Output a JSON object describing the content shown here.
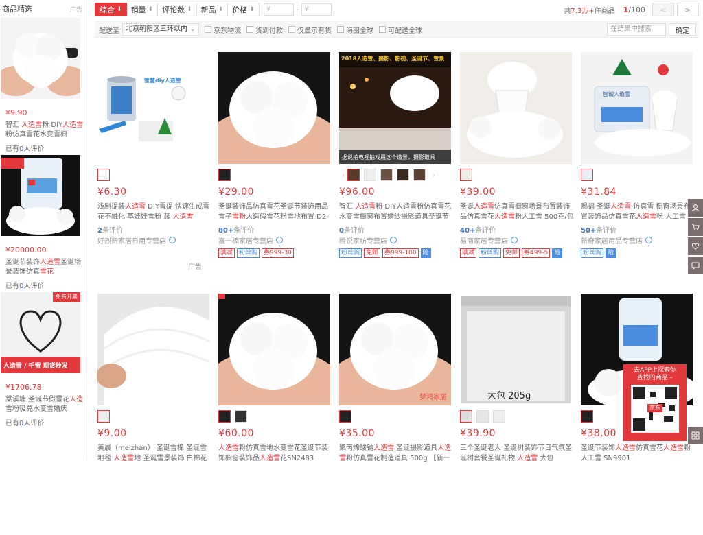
{
  "sidebar": {
    "title": "商品精选",
    "ad": "广告",
    "items": [
      {
        "price": "¥9.90",
        "t1": "智汇 ",
        "k1": "人造雪",
        "t2": "粉 DIY",
        "k2": "人造雪",
        "t3": "粉仿真雪花水变雪橱",
        "eval_pre": "已有",
        "eval_num": "0",
        "eval_post": "人评价"
      },
      {
        "price": "¥20000.00",
        "t1": "圣诞节装饰",
        "k1": "人造雪",
        "t2": "圣诞场景装饰仿真",
        "k2": "雪花",
        "t3": "",
        "eval_pre": "已有",
        "eval_num": "0",
        "eval_post": "人评价"
      },
      {
        "price": "¥1706.78",
        "t1": "棠溪塘 圣诞节假雪花",
        "k1": "人造",
        "t2": "雪粉吸兑水变雪婚庆",
        "k2": "",
        "t3": "",
        "eval_pre": "已有",
        "eval_num": "0",
        "eval_post": "人评价",
        "badge_top": "免费开票",
        "badge_bottom": "人造雪 / 千雪  现货秒发"
      }
    ]
  },
  "sort_bar": {
    "sorts": [
      {
        "label": "综合",
        "arrow": "⬇"
      },
      {
        "label": "销量",
        "arrow": "⬇"
      },
      {
        "label": "评论数",
        "arrow": "⬇"
      },
      {
        "label": "新品",
        "arrow": "⬇"
      },
      {
        "label": "价格",
        "arrow": "⬍"
      }
    ],
    "price_min_placeholder": "¥",
    "price_max_placeholder": "¥",
    "dash": "-",
    "total_pre": "共",
    "total_num": "7.3万+",
    "total_post": "件商品",
    "page_current": "1",
    "page_total": "/100",
    "prev": "<",
    "next": ">"
  },
  "filter_bar": {
    "ship_to": "配送至",
    "location": "北京朝阳区三环以内",
    "options": [
      "京东物流",
      "货到付款",
      "仅显示有货",
      "海囤全球",
      "可配送全球"
    ],
    "search_placeholder": "在结果中搜索",
    "confirm": "确定"
  },
  "products": [
    {
      "price": "¥6.30",
      "t1": "浅剧提装",
      "k1": "人造雪",
      "t2": " DIY雪提 快速生成雪花不融化 草娃娃雪粉 装 ",
      "k2": "人造雪",
      "eval": "2",
      "eval_suffix": "条评价",
      "shop": "好烈新家居日用专营店",
      "tags": [],
      "ad": "广告",
      "banner": "智慧diy人造雪"
    },
    {
      "price": "¥29.00",
      "t1": "圣诞装饰品仿真雪花圣诞节装饰用品雪子",
      "k1": "雪粉",
      "t2": "人造假雪花粉雪地布置 D2-",
      "k2": "",
      "eval": "80+",
      "eval_suffix": "条评价",
      "shop": "嘉一楠家居专营店",
      "tags": [
        {
          "t": "满减",
          "c": ""
        },
        {
          "t": "粉丝购",
          "c": "blue"
        },
        {
          "t": "券999-30",
          "c": ""
        }
      ]
    },
    {
      "price": "¥96.00",
      "t1": "智汇 ",
      "k1": "人造雪",
      "t2": "粉 DIY人造雪粉仿真雪花水变雪橱窗布置婚纱摄影道具圣诞节",
      "k2": "",
      "eval": "0",
      "eval_suffix": "条评价",
      "shop": "腾锐家纺专营店",
      "tags": [
        {
          "t": "粉丝购",
          "c": "blue"
        },
        {
          "t": "免邮",
          "c": ""
        },
        {
          "t": "券999-100",
          "c": ""
        },
        {
          "t": "险",
          "c": "fill"
        }
      ],
      "banner": "2018人造雪、摄影、影视、圣诞节、雪景",
      "caption": "据说拍电视拍戏用这个造景，摄影道具"
    },
    {
      "price": "¥39.00",
      "t1": "圣诞",
      "k1": "人造雪",
      "t2": "仿真雪橱窗场景布置装饰品仿真雪花",
      "k2": "人造雪",
      "t3": "粉人工雪 500克/包",
      "eval": "40+",
      "eval_suffix": "条评价",
      "shop": "易商家居专营店",
      "tags": [
        {
          "t": "满减",
          "c": ""
        },
        {
          "t": "粉丝购",
          "c": "blue"
        },
        {
          "t": "免邮",
          "c": ""
        },
        {
          "t": "券499-5",
          "c": ""
        },
        {
          "t": "险",
          "c": "fill"
        }
      ]
    },
    {
      "price": "¥31.84",
      "t1": "赐福 圣诞",
      "k1": "人造雪",
      "t2": " 仿真雪 橱窗场景布置装饰品仿真雪花",
      "k2": "人造雪",
      "t3": "粉 人工雪",
      "eval": "50+",
      "eval_suffix": "条评价",
      "shop": "新奇家居用品专营店",
      "tags": [
        {
          "t": "粉丝购",
          "c": "blue"
        },
        {
          "t": "险",
          "c": "fill"
        }
      ],
      "banner": "智诚人造雪"
    },
    {
      "price": "¥9.00",
      "t1": "美晨（meizhan） 圣诞雪棉 圣诞雪地毯 ",
      "k1": "人造雪",
      "t2": "地 圣诞雪景装饰 白棉花仿",
      "k2": "",
      "eval": "",
      "eval_suffix": "",
      "shop": "",
      "tags": []
    },
    {
      "price": "¥60.00",
      "t1": "",
      "k1": "人造雪",
      "t2": "粉仿真雪地水变雪花圣诞节装饰橱窗装饰品",
      "k2": "人造雪",
      "t3": "花SN2483 1000g 冬",
      "eval": "",
      "eval_suffix": "",
      "shop": "",
      "tags": []
    },
    {
      "price": "¥35.00",
      "t1": "聚丙烯酸钠",
      "k1": "人造雪",
      "t2": " 圣诞摄影道具",
      "k2": "人造雪",
      "t3": "粉仿真雪花制造道具 500g 【新一",
      "eval": "",
      "eval_suffix": "",
      "shop": "",
      "tags": [],
      "watermark": "梦鸿家居"
    },
    {
      "price": "¥39.90",
      "t1": "三个圣诞老人 圣诞树装饰节日气氛圣诞树套餐圣诞礼物 ",
      "k1": "人造雪",
      "t2": " 大包",
      "k2": "",
      "eval": "",
      "eval_suffix": "",
      "shop": "",
      "tags": [],
      "bag_label": "大包  205g"
    },
    {
      "price": "¥38.00",
      "t1": "圣诞节装饰",
      "k1": "人造雪",
      "t2": "仿真雪花",
      "k2": "人造雪",
      "t3": "粉人工雪 SN9901",
      "eval": "",
      "eval_suffix": "",
      "shop": "",
      "tags": []
    }
  ],
  "qr_popup": {
    "line1": "去APP上探索你",
    "line2": "查找的商品~",
    "brand": "京东"
  },
  "right_bar": {
    "icons": [
      "user-icon",
      "cart-icon",
      "heart-icon",
      "message-icon",
      "grid-icon"
    ]
  }
}
